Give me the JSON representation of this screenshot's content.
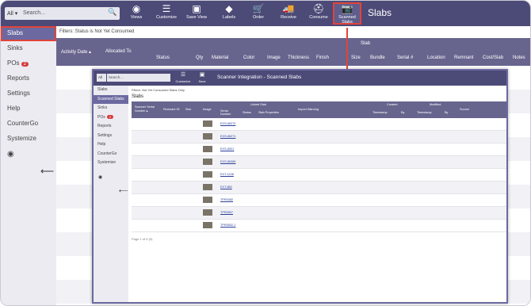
{
  "app": {
    "select_value": "All",
    "search_placeholder": "Search...",
    "title": "Slabs",
    "toolbar": [
      {
        "label": "Views",
        "icon": "eye-icon"
      },
      {
        "label": "Customize",
        "icon": "sliders-icon"
      },
      {
        "label": "Save View",
        "icon": "save-icon"
      },
      {
        "label": "Labels",
        "icon": "tag-icon"
      },
      {
        "label": "Order",
        "icon": "cart-icon"
      },
      {
        "label": "Receive",
        "icon": "truck-icon"
      },
      {
        "label": "Consume",
        "icon": "hard-hat-icon"
      },
      {
        "label": "Scanned Slabs",
        "icon": "camera-icon"
      }
    ],
    "sidebar": [
      {
        "label": "Slabs"
      },
      {
        "label": "Sinks"
      },
      {
        "label": "POs",
        "badge": "2"
      },
      {
        "label": "Reports"
      },
      {
        "label": "Settings"
      },
      {
        "label": "Help"
      },
      {
        "label": "CounterGo"
      },
      {
        "label": "Systemize"
      }
    ],
    "filters": "Filters:   Status is Not Yet Consumed",
    "columns": {
      "activity": "Activity Date ▴",
      "allocated": "Allocated To",
      "slab_group": "Slab",
      "status": "Status",
      "qty": "Qty",
      "material": "Material",
      "color": "Color",
      "image": "Image",
      "thickness": "Thickness",
      "finish": "Finish",
      "size": "Size",
      "bundle": "Bundle",
      "serial": "Serial #",
      "location": "Location",
      "remnant": "Remnant",
      "cost": "Cost/Slab",
      "notes": "Notes"
    }
  },
  "overlay": {
    "select_value": "All",
    "search_placeholder": "Search...",
    "title": "Scanner Integration - Scanned Slabs",
    "toolbar": [
      {
        "label": "Customize"
      },
      {
        "label": "Save"
      }
    ],
    "sidebar": [
      {
        "label": "Slabs"
      },
      {
        "label": "Scanned Slabs"
      },
      {
        "label": "Sinks"
      },
      {
        "label": "POs",
        "badge": "2"
      },
      {
        "label": "Reports"
      },
      {
        "label": "Settings"
      },
      {
        "label": "Help"
      },
      {
        "label": "CounterGo"
      },
      {
        "label": "Systemize"
      }
    ],
    "filters": "Filters:   Not Yet Consumed Slabs Only",
    "heading": "Slabs",
    "columns": {
      "serial": "Scanner Serial Number ▴",
      "remnant": "Remnant Of",
      "size": "Size",
      "image": "Image",
      "linked": "Linked Slab",
      "lserial": "Serial Number",
      "lstatus": "Status",
      "lprops": "Slab Properties",
      "warning": "Import Warning",
      "created": "Created",
      "cts": "Timestamp",
      "cby": "By",
      "modified": "Modified",
      "mts": "Timestamp",
      "mby": "By",
      "source": "Source"
    },
    "rows": [
      {
        "link": "EXS-66270"
      },
      {
        "link": "EXS-66271"
      },
      {
        "link": "EXS-8001"
      },
      {
        "link": "EXS-66389"
      },
      {
        "link": "EXT-1228"
      },
      {
        "link": "EXT-880"
      },
      {
        "link": "TPR5382"
      },
      {
        "link": "TPR5507"
      },
      {
        "link": "TPR5502-1"
      }
    ],
    "footer": "Page 1 of 9 (9)"
  }
}
